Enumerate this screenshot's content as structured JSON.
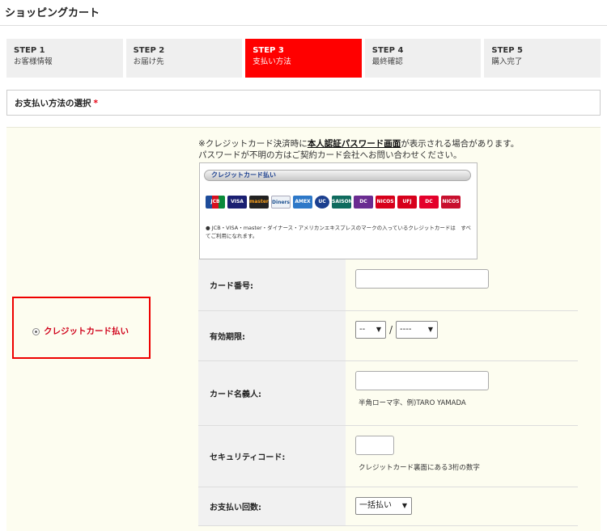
{
  "header": {
    "title": "ショッピングカート"
  },
  "steps": [
    {
      "num": "STEP 1",
      "label": "お客様情報"
    },
    {
      "num": "STEP 2",
      "label": "お届け先"
    },
    {
      "num": "STEP 3",
      "label": "支払い方法",
      "active": true
    },
    {
      "num": "STEP 4",
      "label": "最終確認"
    },
    {
      "num": "STEP 5",
      "label": "購入完了"
    }
  ],
  "section": {
    "title": "お支払い方法の選択",
    "required_mark": "*"
  },
  "payment_method": {
    "label": "クレジットカード払い"
  },
  "notice": {
    "line1_pre": "※クレジットカード決済時に",
    "line1_link": "本人認証パスワード画面",
    "line1_post": "が表示される場合があります。",
    "line2": "パスワードが不明の方はご契約カード会社へお問い合わせください。"
  },
  "cc_banner": {
    "title": "クレジットカード払い",
    "brands": [
      "JCB",
      "VISA",
      "master",
      "Diners",
      "AMEX",
      "UC",
      "SAISON",
      "DC",
      "NICOS",
      "UFJ",
      "DC",
      "NICOS"
    ],
    "note": "● JCB・VISA・master・ダイナース・アメリカンエキスプレスのマークの入っているクレジットカードは　すべてご利用になれます。"
  },
  "form": {
    "card_number_label": "カード番号:",
    "expiry_label": "有効期限:",
    "expiry_month": "--",
    "expiry_year": "----",
    "expiry_sep": "/",
    "holder_label": "カード名義人:",
    "holder_hint": "半角ローマ字、例)TARO YAMADA",
    "cvc_label": "セキュリティコード:",
    "cvc_hint": "クレジットカード裏面にある3桁の数字",
    "installments_label": "お支払い回数:",
    "installments_value": "一括払い"
  },
  "colors": {
    "accent": "#ff0000",
    "method_text": "#d0021b"
  }
}
